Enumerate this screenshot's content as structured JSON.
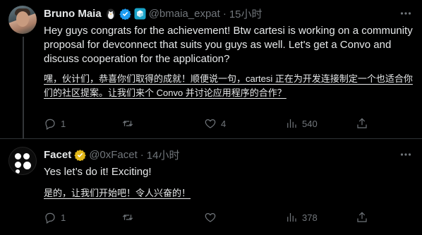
{
  "tweets": [
    {
      "name": "Bruno Maia",
      "handle": "@bmaia_expat",
      "sep": "·",
      "time": "15小时",
      "text": "Hey guys congrats for the achievement! Btw cartesi is working on a community proposal for devconnect that suits you guys as well. Let's get a Convo and discuss cooperation for the application?",
      "translation": "嘿，伙计们，恭喜你们取得的成就！顺便说一句，cartesi 正在为开发连接制定一个也适合你们的社区提案。让我们来个 Convo 并讨论应用程序的合作？",
      "replies": "1",
      "retweets": "",
      "likes": "4",
      "views": "540",
      "icons": [
        "penguin-emoji-icon",
        "verified-badge-icon",
        "cube-emoji-icon"
      ]
    },
    {
      "name": "Facet",
      "handle": "@0xFacet",
      "sep": "·",
      "time": "14小时",
      "text": "Yes let’s do it! Exciting!",
      "translation": "是的，让我们开始吧！令人兴奋的！",
      "replies": "1",
      "retweets": "",
      "likes": "",
      "views": "378",
      "icons": [
        "gold-verified-badge-icon"
      ]
    }
  ],
  "colors": {
    "bg": "#000000",
    "text": "#e7e9ea",
    "muted": "#71767b",
    "verified_blue": "#1d9bf0",
    "verified_gold": "#e2b719",
    "divider": "#2f3336"
  }
}
